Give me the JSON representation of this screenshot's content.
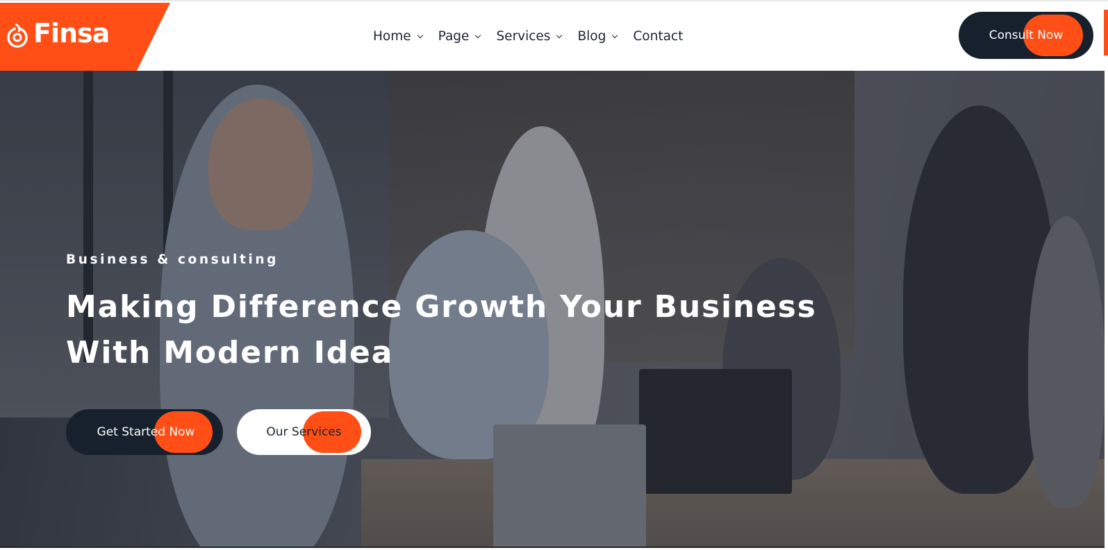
{
  "brand": {
    "name": "Finsa",
    "accent_color": "#ff4f17",
    "dark_color": "#16212d"
  },
  "nav": {
    "items": [
      {
        "label": "Home",
        "has_dropdown": true
      },
      {
        "label": "Page",
        "has_dropdown": true
      },
      {
        "label": "Services",
        "has_dropdown": true
      },
      {
        "label": "Blog",
        "has_dropdown": true
      },
      {
        "label": "Contact",
        "has_dropdown": false
      }
    ],
    "cta_label": "Consult Now"
  },
  "hero": {
    "kicker": "Business & consulting",
    "headline_line1": "Making Difference Growth Your Business",
    "headline_line2": "With Modern Idea",
    "primary_button": "Get Started Now",
    "secondary_button": "Our Services",
    "background_image": "business-meeting-photo"
  }
}
